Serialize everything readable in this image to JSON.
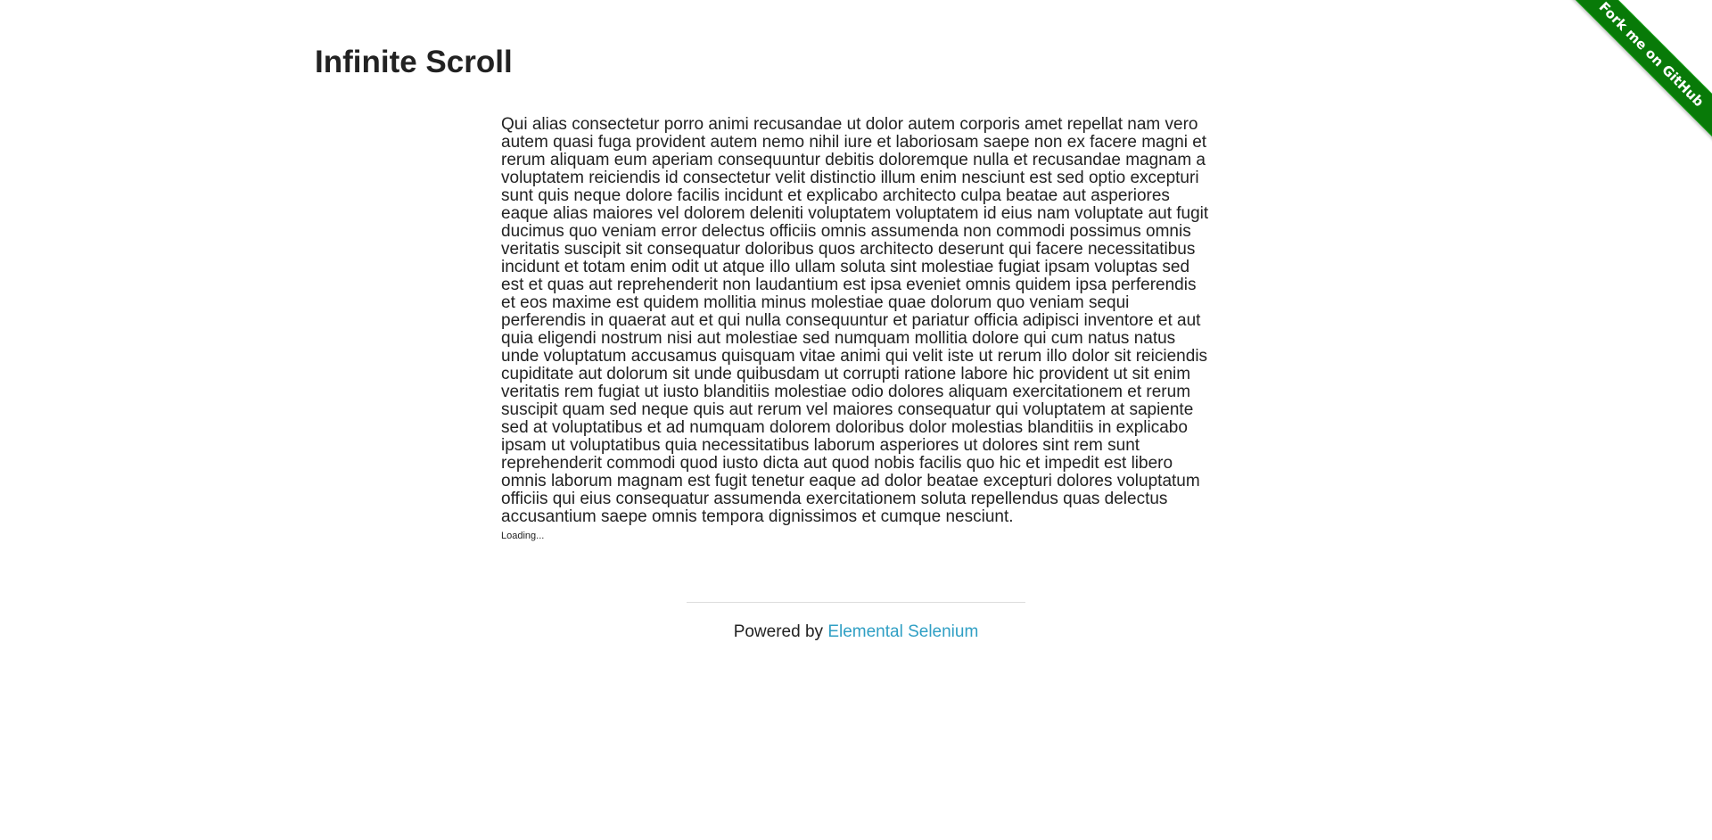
{
  "page": {
    "title": "Infinite Scroll"
  },
  "content": {
    "paragraph": "Qui alias consectetur porro animi recusandae ut dolor autem corporis amet repellat nam vero autem quasi fuga provident autem nemo nihil iure et laboriosam saepe non ex facere magni et rerum aliquam eum aperiam consequuntur debitis doloremque nulla et recusandae magnam a voluptatem reiciendis id consectetur velit distinctio illum enim nesciunt est sed optio excepturi sunt quis neque dolore facilis incidunt et explicabo architecto culpa beatae aut asperiores eaque alias maiores vel dolorem deleniti voluptatem voluptatem id eius nam voluptate aut fugit ducimus quo veniam error delectus officiis omnis assumenda non commodi possimus omnis veritatis suscipit sit consequatur doloribus quos architecto deserunt qui facere necessitatibus incidunt et totam enim odit ut atque illo ullam soluta sint molestiae fugiat ipsam voluptas sed est et quas aut reprehenderit non laudantium est ipsa eveniet omnis quidem ipsa perferendis et eos maxime est quidem mollitia minus molestiae quae dolorum quo veniam sequi perferendis in quaerat aut et qui nulla consequuntur et pariatur officia adipisci inventore et aut quia eligendi nostrum nisi aut molestiae sed numquam mollitia dolore qui cum natus natus unde voluptatum accusamus quisquam vitae animi qui velit iste ut rerum illo dolor sit reiciendis cupiditate aut dolorum sit unde quibusdam ut corrupti ratione labore hic provident ut sit enim veritatis rem fugiat ut iusto blanditiis molestiae odio dolores aliquam exercitationem et rerum suscipit quam sed neque quis aut rerum vel maiores consequatur qui voluptatem at sapiente sed at voluptatibus et ad numquam dolorem doloribus dolor molestias blanditiis in explicabo ipsam ut voluptatibus quia necessitatibus laborum asperiores ut dolores sint rem sunt reprehenderit commodi quod iusto dicta aut quod nobis facilis quo hic et impedit est libero omnis laborum magnam est fugit tenetur eaque ad dolor beatae excepturi dolores voluptatum officiis qui eius consequatur assumenda exercitationem soluta repellendus quas delectus accusantium saepe omnis tempora dignissimos et cumque nesciunt.",
    "loading": "Loading..."
  },
  "footer": {
    "prefix": "Powered by ",
    "link_label": "Elemental Selenium",
    "link_color": "#2f9fc4"
  },
  "ribbon": {
    "label": "Fork me on GitHub",
    "color": "#087a08"
  }
}
